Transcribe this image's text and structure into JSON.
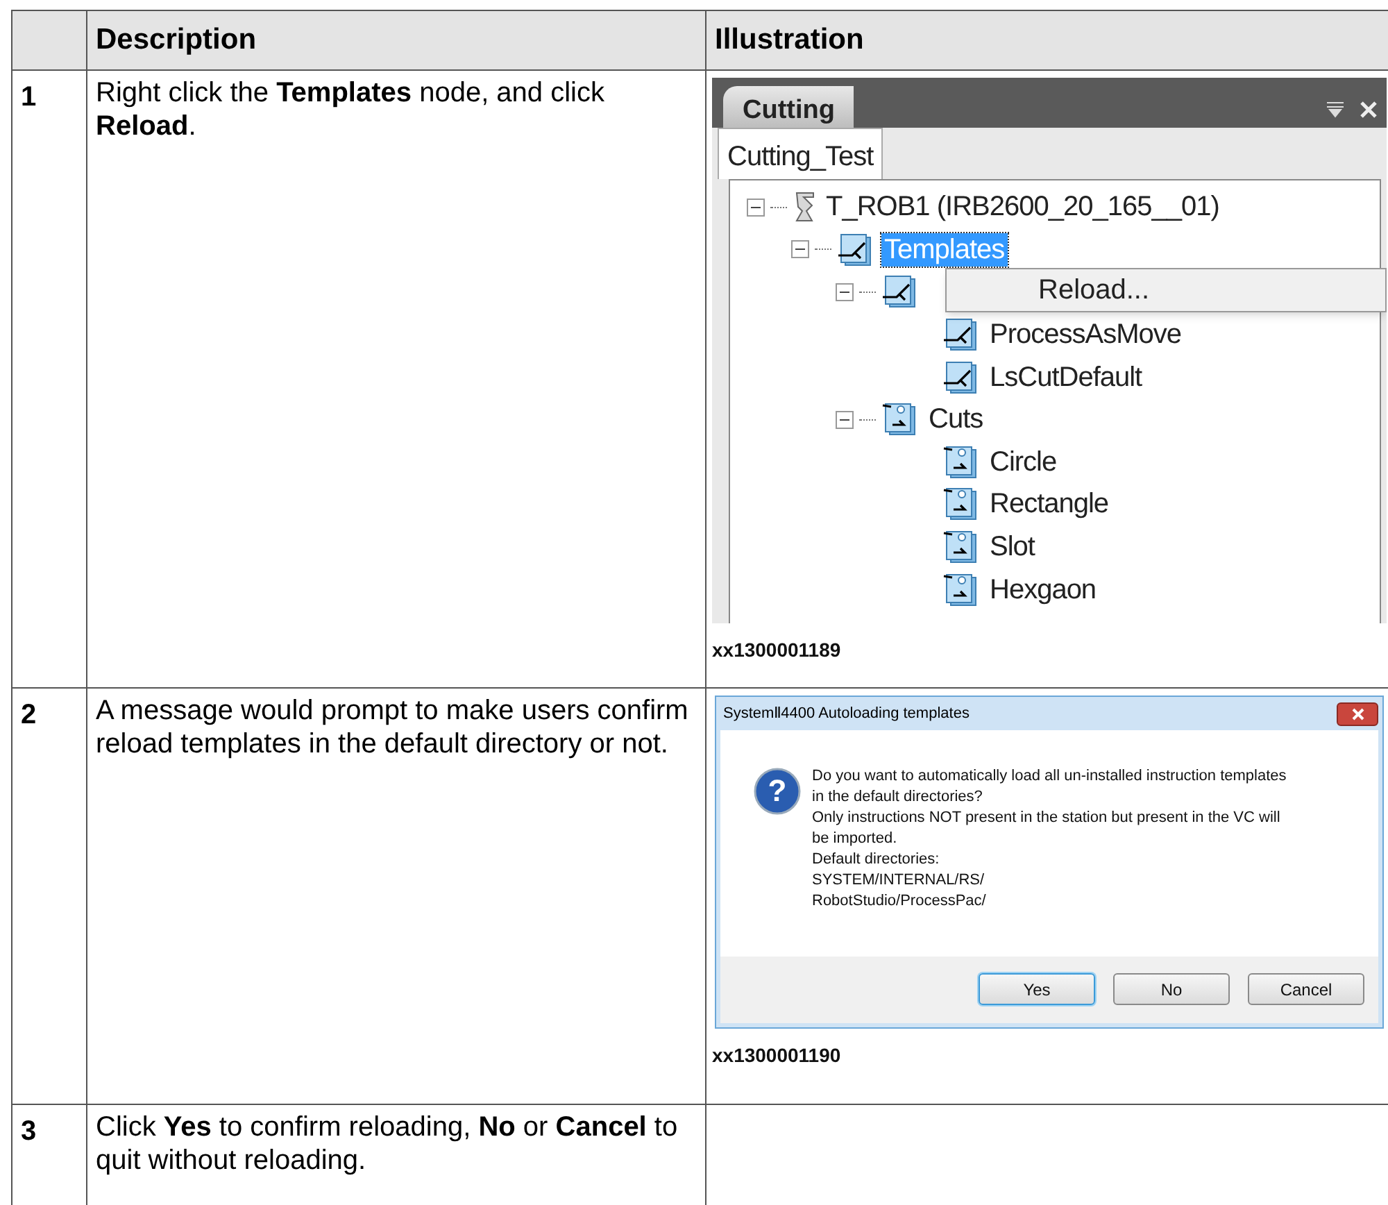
{
  "table": {
    "columns": [
      "",
      "Description",
      "Illustration"
    ],
    "rows": [
      {
        "number": "1",
        "description": "Right click the **Templates** node, and click **Reload**.",
        "illustration": {
          "kind": "tree_panel",
          "caption": "xx1300001189"
        },
        "panel": {
          "title_tab": "Cutting",
          "subtab": "Cutting_Test",
          "tree": [
            {
              "label": "T_ROB1 (IRB2600_20_165__01)",
              "kind": "robot",
              "expanded": true,
              "selected": false,
              "children": [
                {
                  "label": "Templates",
                  "kind": "template",
                  "expanded": true,
                  "selected": true,
                  "children": [
                    {
                      "kind": "template",
                      "expanded": true,
                      "children": [
                        {
                          "label": "ProcessAsMove",
                          "kind": "template",
                          "selected": false
                        },
                        {
                          "label": "LsCutDefault",
                          "kind": "template",
                          "selected": false
                        }
                      ]
                    },
                    {
                      "label": "Cuts",
                      "kind": "cut",
                      "expanded": true,
                      "selected": false,
                      "children": [
                        {
                          "label": "Circle",
                          "kind": "cut",
                          "selected": false
                        },
                        {
                          "label": "Rectangle",
                          "kind": "cut",
                          "selected": false
                        },
                        {
                          "label": "Slot",
                          "kind": "cut",
                          "selected": false
                        },
                        {
                          "label": "Hexgaon",
                          "kind": "cut",
                          "selected": false
                        }
                      ]
                    }
                  ]
                }
              ]
            }
          ],
          "context_menu": [
            "Reload..."
          ]
        }
      },
      {
        "number": "2",
        "description": "A message would prompt to make users confirm reload templates in the default directory or not.",
        "illustration": {
          "kind": "dialog",
          "caption": "xx1300001190"
        },
        "dialog": {
          "icon_glyph": "?",
          "title": "SystemⅡ4400 Autoloading templates",
          "lines": [
            "Do you want to automatically load all un-installed instruction templates",
            "in the default directories?",
            "Only instructions NOT present in the station but present in the VC will",
            "be imported.",
            "Default directories:",
            "SYSTEM/INTERNAL/RS/",
            "RobotStudio/ProcessPac/"
          ],
          "buttons": [
            {
              "label": "Yes",
              "selected": true
            },
            {
              "label": "No",
              "selected": false
            },
            {
              "label": "Cancel",
              "selected": false
            }
          ]
        }
      },
      {
        "number": "3",
        "description": "Click **Yes** to confirm reloading, **No** or **Cancel** to quit without reloading."
      }
    ]
  }
}
